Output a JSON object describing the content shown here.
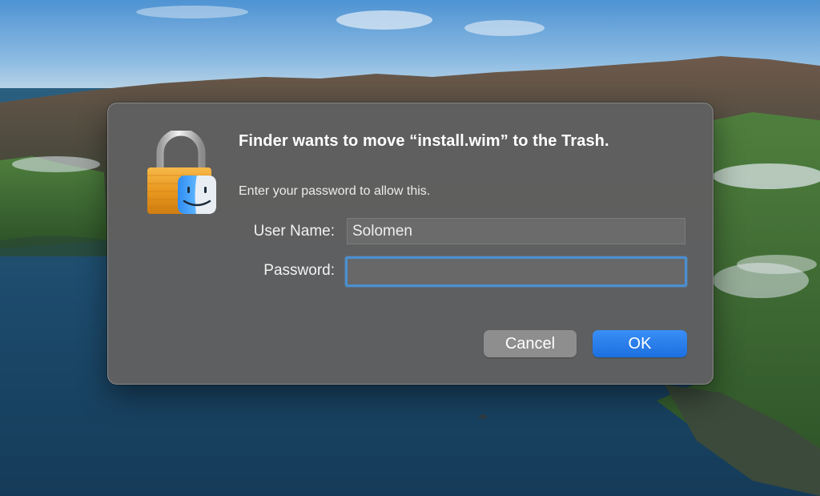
{
  "dialog": {
    "title": "Finder wants to move “install.wim” to the Trash.",
    "message": "Enter your password to allow this.",
    "username_label": "User Name:",
    "username_value": "Solomen",
    "password_label": "Password:",
    "password_value": "",
    "cancel_label": "Cancel",
    "ok_label": "OK",
    "icon": "lock-finder-icon"
  },
  "colors": {
    "dialog_bg": "#606060",
    "focus_ring": "#4a8fd0",
    "ok_button": "#1c6fe0",
    "cancel_button": "#8e8e8e"
  }
}
